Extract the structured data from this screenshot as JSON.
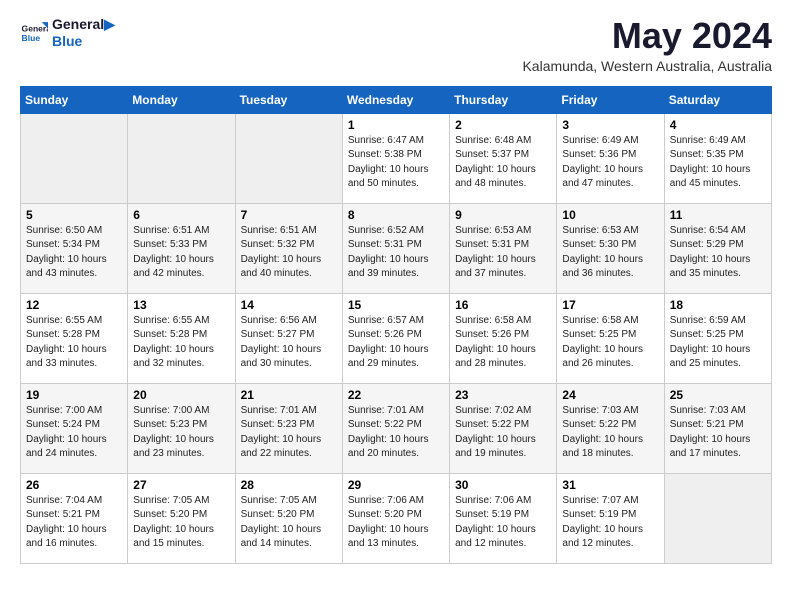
{
  "header": {
    "logo_line1": "General",
    "logo_line2": "Blue",
    "month": "May 2024",
    "location": "Kalamunda, Western Australia, Australia"
  },
  "weekdays": [
    "Sunday",
    "Monday",
    "Tuesday",
    "Wednesday",
    "Thursday",
    "Friday",
    "Saturday"
  ],
  "weeks": [
    [
      {
        "day": "",
        "info": ""
      },
      {
        "day": "",
        "info": ""
      },
      {
        "day": "",
        "info": ""
      },
      {
        "day": "1",
        "info": "Sunrise: 6:47 AM\nSunset: 5:38 PM\nDaylight: 10 hours\nand 50 minutes."
      },
      {
        "day": "2",
        "info": "Sunrise: 6:48 AM\nSunset: 5:37 PM\nDaylight: 10 hours\nand 48 minutes."
      },
      {
        "day": "3",
        "info": "Sunrise: 6:49 AM\nSunset: 5:36 PM\nDaylight: 10 hours\nand 47 minutes."
      },
      {
        "day": "4",
        "info": "Sunrise: 6:49 AM\nSunset: 5:35 PM\nDaylight: 10 hours\nand 45 minutes."
      }
    ],
    [
      {
        "day": "5",
        "info": "Sunrise: 6:50 AM\nSunset: 5:34 PM\nDaylight: 10 hours\nand 43 minutes."
      },
      {
        "day": "6",
        "info": "Sunrise: 6:51 AM\nSunset: 5:33 PM\nDaylight: 10 hours\nand 42 minutes."
      },
      {
        "day": "7",
        "info": "Sunrise: 6:51 AM\nSunset: 5:32 PM\nDaylight: 10 hours\nand 40 minutes."
      },
      {
        "day": "8",
        "info": "Sunrise: 6:52 AM\nSunset: 5:31 PM\nDaylight: 10 hours\nand 39 minutes."
      },
      {
        "day": "9",
        "info": "Sunrise: 6:53 AM\nSunset: 5:31 PM\nDaylight: 10 hours\nand 37 minutes."
      },
      {
        "day": "10",
        "info": "Sunrise: 6:53 AM\nSunset: 5:30 PM\nDaylight: 10 hours\nand 36 minutes."
      },
      {
        "day": "11",
        "info": "Sunrise: 6:54 AM\nSunset: 5:29 PM\nDaylight: 10 hours\nand 35 minutes."
      }
    ],
    [
      {
        "day": "12",
        "info": "Sunrise: 6:55 AM\nSunset: 5:28 PM\nDaylight: 10 hours\nand 33 minutes."
      },
      {
        "day": "13",
        "info": "Sunrise: 6:55 AM\nSunset: 5:28 PM\nDaylight: 10 hours\nand 32 minutes."
      },
      {
        "day": "14",
        "info": "Sunrise: 6:56 AM\nSunset: 5:27 PM\nDaylight: 10 hours\nand 30 minutes."
      },
      {
        "day": "15",
        "info": "Sunrise: 6:57 AM\nSunset: 5:26 PM\nDaylight: 10 hours\nand 29 minutes."
      },
      {
        "day": "16",
        "info": "Sunrise: 6:58 AM\nSunset: 5:26 PM\nDaylight: 10 hours\nand 28 minutes."
      },
      {
        "day": "17",
        "info": "Sunrise: 6:58 AM\nSunset: 5:25 PM\nDaylight: 10 hours\nand 26 minutes."
      },
      {
        "day": "18",
        "info": "Sunrise: 6:59 AM\nSunset: 5:25 PM\nDaylight: 10 hours\nand 25 minutes."
      }
    ],
    [
      {
        "day": "19",
        "info": "Sunrise: 7:00 AM\nSunset: 5:24 PM\nDaylight: 10 hours\nand 24 minutes."
      },
      {
        "day": "20",
        "info": "Sunrise: 7:00 AM\nSunset: 5:23 PM\nDaylight: 10 hours\nand 23 minutes."
      },
      {
        "day": "21",
        "info": "Sunrise: 7:01 AM\nSunset: 5:23 PM\nDaylight: 10 hours\nand 22 minutes."
      },
      {
        "day": "22",
        "info": "Sunrise: 7:01 AM\nSunset: 5:22 PM\nDaylight: 10 hours\nand 20 minutes."
      },
      {
        "day": "23",
        "info": "Sunrise: 7:02 AM\nSunset: 5:22 PM\nDaylight: 10 hours\nand 19 minutes."
      },
      {
        "day": "24",
        "info": "Sunrise: 7:03 AM\nSunset: 5:22 PM\nDaylight: 10 hours\nand 18 minutes."
      },
      {
        "day": "25",
        "info": "Sunrise: 7:03 AM\nSunset: 5:21 PM\nDaylight: 10 hours\nand 17 minutes."
      }
    ],
    [
      {
        "day": "26",
        "info": "Sunrise: 7:04 AM\nSunset: 5:21 PM\nDaylight: 10 hours\nand 16 minutes."
      },
      {
        "day": "27",
        "info": "Sunrise: 7:05 AM\nSunset: 5:20 PM\nDaylight: 10 hours\nand 15 minutes."
      },
      {
        "day": "28",
        "info": "Sunrise: 7:05 AM\nSunset: 5:20 PM\nDaylight: 10 hours\nand 14 minutes."
      },
      {
        "day": "29",
        "info": "Sunrise: 7:06 AM\nSunset: 5:20 PM\nDaylight: 10 hours\nand 13 minutes."
      },
      {
        "day": "30",
        "info": "Sunrise: 7:06 AM\nSunset: 5:19 PM\nDaylight: 10 hours\nand 12 minutes."
      },
      {
        "day": "31",
        "info": "Sunrise: 7:07 AM\nSunset: 5:19 PM\nDaylight: 10 hours\nand 12 minutes."
      },
      {
        "day": "",
        "info": ""
      }
    ]
  ]
}
